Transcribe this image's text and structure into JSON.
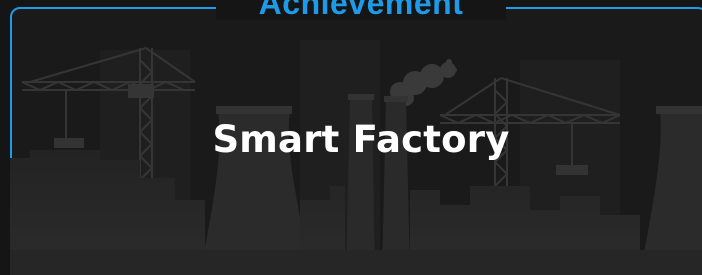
{
  "card": {
    "badge_label": "Achievement",
    "title": "Smart Factory"
  },
  "colors": {
    "accent": "#1e9be8",
    "background": "#1a1a1a",
    "silhouette": "#2b2b2b",
    "title_text": "#ffffff"
  },
  "icons": [
    "tower-crane-illustration",
    "factory-chimney-illustration",
    "smoke-cloud-illustration",
    "cooling-tower-illustration"
  ]
}
